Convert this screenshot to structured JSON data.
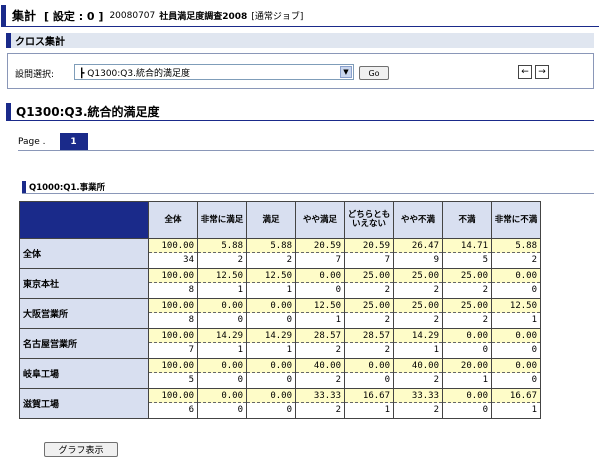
{
  "header": {
    "title": "集計",
    "setting": "[ 設定 : 0 ]",
    "date": "20080707",
    "survey_name": "社員満足度調査2008",
    "job_type": "[通常ジョブ]"
  },
  "cross_section": {
    "title": "クロス集計"
  },
  "question_select": {
    "label": "設問選択:",
    "selected": "┣ Q1300:Q3.統合的満足度",
    "go_label": "Go",
    "prev_label": "←",
    "next_label": "→"
  },
  "question_title": "Q1300:Q3.統合的満足度",
  "pager": {
    "label": "Page .",
    "current": "1"
  },
  "sub_question": "Q1000:Q1.事業所",
  "table": {
    "columns": [
      "全体",
      "非常に満足",
      "満足",
      "やや満足",
      "どちらともいえない",
      "やや不満",
      "不満",
      "非常に不満"
    ],
    "rows": [
      {
        "label": "全体",
        "pct": [
          "100.00",
          "5.88",
          "5.88",
          "20.59",
          "20.59",
          "26.47",
          "14.71",
          "5.88"
        ],
        "cnt": [
          "34",
          "2",
          "2",
          "7",
          "7",
          "9",
          "5",
          "2"
        ]
      },
      {
        "label": "東京本社",
        "pct": [
          "100.00",
          "12.50",
          "12.50",
          "0.00",
          "25.00",
          "25.00",
          "25.00",
          "0.00"
        ],
        "cnt": [
          "8",
          "1",
          "1",
          "0",
          "2",
          "2",
          "2",
          "0"
        ]
      },
      {
        "label": "大阪営業所",
        "pct": [
          "100.00",
          "0.00",
          "0.00",
          "12.50",
          "25.00",
          "25.00",
          "25.00",
          "12.50"
        ],
        "cnt": [
          "8",
          "0",
          "0",
          "1",
          "2",
          "2",
          "2",
          "1"
        ]
      },
      {
        "label": "名古屋営業所",
        "pct": [
          "100.00",
          "14.29",
          "14.29",
          "28.57",
          "28.57",
          "14.29",
          "0.00",
          "0.00"
        ],
        "cnt": [
          "7",
          "1",
          "1",
          "2",
          "2",
          "1",
          "0",
          "0"
        ]
      },
      {
        "label": "岐阜工場",
        "pct": [
          "100.00",
          "0.00",
          "0.00",
          "40.00",
          "0.00",
          "40.00",
          "20.00",
          "0.00"
        ],
        "cnt": [
          "5",
          "0",
          "0",
          "2",
          "0",
          "2",
          "1",
          "0"
        ]
      },
      {
        "label": "滋賀工場",
        "pct": [
          "100.00",
          "0.00",
          "0.00",
          "33.33",
          "16.67",
          "33.33",
          "0.00",
          "16.67"
        ],
        "cnt": [
          "6",
          "0",
          "0",
          "2",
          "1",
          "2",
          "0",
          "1"
        ]
      }
    ]
  },
  "graph_button": "グラフ表示",
  "colors": {
    "accent": "#1a2a8a",
    "header_cell": "#d8dff0",
    "pct_cell": "#fefcc8"
  }
}
